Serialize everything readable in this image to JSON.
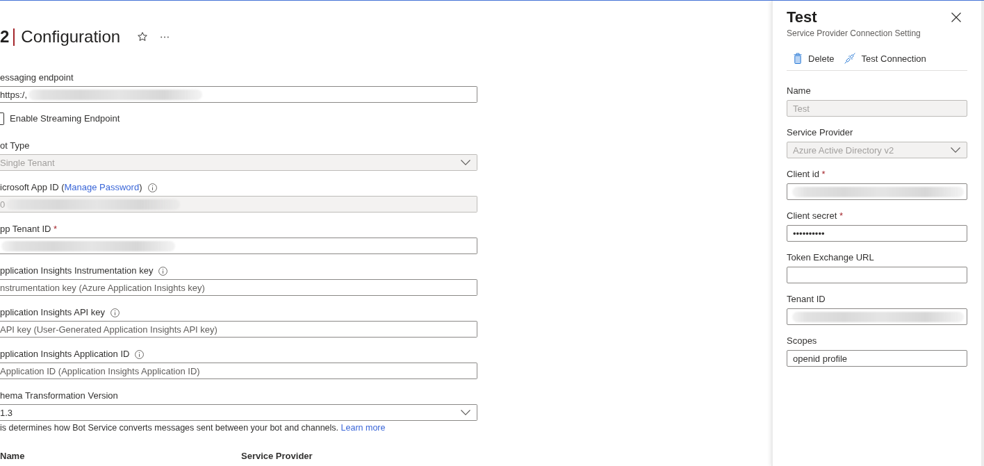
{
  "header": {
    "title_prefix": "2",
    "title": "Configuration"
  },
  "form": {
    "fields": [
      {
        "kind": "text",
        "label": "essaging endpoint",
        "value": "https:/,",
        "redacted": true,
        "disabled": false
      },
      {
        "kind": "checkbox",
        "label": "Enable Streaming Endpoint",
        "checked": false
      },
      {
        "kind": "dropdown",
        "label": "ot Type",
        "value": "Single Tenant",
        "disabled": true
      },
      {
        "kind": "text",
        "label": "icrosoft App ID (",
        "label_link": "Manage Password",
        "label_after": ")",
        "value": "0",
        "redacted": true,
        "disabled": true,
        "info": true
      },
      {
        "kind": "text",
        "label": "pp Tenant ID",
        "required_mark": "*",
        "redacted": true,
        "disabled": false
      },
      {
        "kind": "text",
        "label": "pplication Insights Instrumentation key",
        "placeholder": "nstrumentation key (Azure Application Insights key)",
        "disabled": false,
        "info": true
      },
      {
        "kind": "text",
        "label": "pplication Insights API key",
        "placeholder": "API key (User-Generated Application Insights API key)",
        "disabled": false,
        "info": true
      },
      {
        "kind": "text",
        "label": "pplication Insights Application ID",
        "placeholder": "Application ID (Application Insights Application ID)",
        "disabled": false,
        "info": true
      },
      {
        "kind": "dropdown",
        "label": "hema Transformation Version",
        "value": "1.3",
        "disabled": false,
        "help": "is determines how Bot Service converts messages sent between your bot and channels.",
        "help_link": "Learn more"
      }
    ]
  },
  "table": {
    "columns": [
      "Name",
      "Service Provider"
    ]
  },
  "panel": {
    "title": "Test",
    "subtitle": "Service Provider Connection Setting",
    "actions": [
      {
        "kind": "delete",
        "label": "Delete"
      },
      {
        "kind": "test",
        "label": "Test Connection"
      }
    ],
    "fields": [
      {
        "kind": "text",
        "label": "Name",
        "value": "Test",
        "disabled": true
      },
      {
        "kind": "dropdown",
        "label": "Service Provider",
        "value": "Azure Active Directory v2",
        "disabled": true
      },
      {
        "kind": "text",
        "label": "Client id",
        "required_mark": "*",
        "redacted": true,
        "disabled": false
      },
      {
        "kind": "text",
        "label": "Client secret",
        "required_mark": "*",
        "value": "••••••••••",
        "disabled": false
      },
      {
        "kind": "text",
        "label": "Token Exchange URL",
        "disabled": false
      },
      {
        "kind": "text",
        "label": "Tenant ID",
        "redacted": true,
        "disabled": false
      },
      {
        "kind": "text",
        "label": "Scopes",
        "value": "openid profile",
        "disabled": false
      }
    ]
  }
}
